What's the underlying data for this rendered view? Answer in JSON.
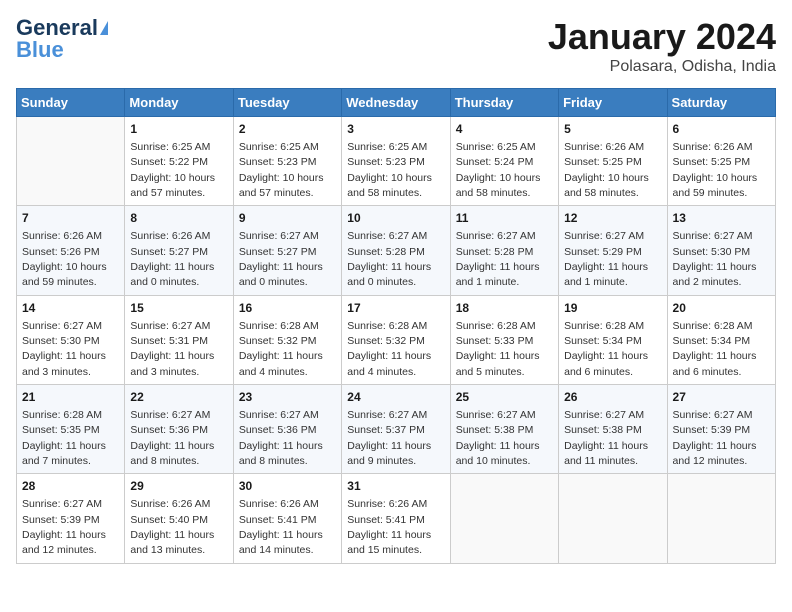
{
  "header": {
    "logo_line1": "General",
    "logo_line2": "Blue",
    "month": "January 2024",
    "location": "Polasara, Odisha, India"
  },
  "days_of_week": [
    "Sunday",
    "Monday",
    "Tuesday",
    "Wednesday",
    "Thursday",
    "Friday",
    "Saturday"
  ],
  "weeks": [
    [
      {
        "day": "",
        "info": ""
      },
      {
        "day": "1",
        "info": "Sunrise: 6:25 AM\nSunset: 5:22 PM\nDaylight: 10 hours and 57 minutes."
      },
      {
        "day": "2",
        "info": "Sunrise: 6:25 AM\nSunset: 5:23 PM\nDaylight: 10 hours and 57 minutes."
      },
      {
        "day": "3",
        "info": "Sunrise: 6:25 AM\nSunset: 5:23 PM\nDaylight: 10 hours and 58 minutes."
      },
      {
        "day": "4",
        "info": "Sunrise: 6:25 AM\nSunset: 5:24 PM\nDaylight: 10 hours and 58 minutes."
      },
      {
        "day": "5",
        "info": "Sunrise: 6:26 AM\nSunset: 5:25 PM\nDaylight: 10 hours and 58 minutes."
      },
      {
        "day": "6",
        "info": "Sunrise: 6:26 AM\nSunset: 5:25 PM\nDaylight: 10 hours and 59 minutes."
      }
    ],
    [
      {
        "day": "7",
        "info": "Sunrise: 6:26 AM\nSunset: 5:26 PM\nDaylight: 10 hours and 59 minutes."
      },
      {
        "day": "8",
        "info": "Sunrise: 6:26 AM\nSunset: 5:27 PM\nDaylight: 11 hours and 0 minutes."
      },
      {
        "day": "9",
        "info": "Sunrise: 6:27 AM\nSunset: 5:27 PM\nDaylight: 11 hours and 0 minutes."
      },
      {
        "day": "10",
        "info": "Sunrise: 6:27 AM\nSunset: 5:28 PM\nDaylight: 11 hours and 0 minutes."
      },
      {
        "day": "11",
        "info": "Sunrise: 6:27 AM\nSunset: 5:28 PM\nDaylight: 11 hours and 1 minute."
      },
      {
        "day": "12",
        "info": "Sunrise: 6:27 AM\nSunset: 5:29 PM\nDaylight: 11 hours and 1 minute."
      },
      {
        "day": "13",
        "info": "Sunrise: 6:27 AM\nSunset: 5:30 PM\nDaylight: 11 hours and 2 minutes."
      }
    ],
    [
      {
        "day": "14",
        "info": "Sunrise: 6:27 AM\nSunset: 5:30 PM\nDaylight: 11 hours and 3 minutes."
      },
      {
        "day": "15",
        "info": "Sunrise: 6:27 AM\nSunset: 5:31 PM\nDaylight: 11 hours and 3 minutes."
      },
      {
        "day": "16",
        "info": "Sunrise: 6:28 AM\nSunset: 5:32 PM\nDaylight: 11 hours and 4 minutes."
      },
      {
        "day": "17",
        "info": "Sunrise: 6:28 AM\nSunset: 5:32 PM\nDaylight: 11 hours and 4 minutes."
      },
      {
        "day": "18",
        "info": "Sunrise: 6:28 AM\nSunset: 5:33 PM\nDaylight: 11 hours and 5 minutes."
      },
      {
        "day": "19",
        "info": "Sunrise: 6:28 AM\nSunset: 5:34 PM\nDaylight: 11 hours and 6 minutes."
      },
      {
        "day": "20",
        "info": "Sunrise: 6:28 AM\nSunset: 5:34 PM\nDaylight: 11 hours and 6 minutes."
      }
    ],
    [
      {
        "day": "21",
        "info": "Sunrise: 6:28 AM\nSunset: 5:35 PM\nDaylight: 11 hours and 7 minutes."
      },
      {
        "day": "22",
        "info": "Sunrise: 6:27 AM\nSunset: 5:36 PM\nDaylight: 11 hours and 8 minutes."
      },
      {
        "day": "23",
        "info": "Sunrise: 6:27 AM\nSunset: 5:36 PM\nDaylight: 11 hours and 8 minutes."
      },
      {
        "day": "24",
        "info": "Sunrise: 6:27 AM\nSunset: 5:37 PM\nDaylight: 11 hours and 9 minutes."
      },
      {
        "day": "25",
        "info": "Sunrise: 6:27 AM\nSunset: 5:38 PM\nDaylight: 11 hours and 10 minutes."
      },
      {
        "day": "26",
        "info": "Sunrise: 6:27 AM\nSunset: 5:38 PM\nDaylight: 11 hours and 11 minutes."
      },
      {
        "day": "27",
        "info": "Sunrise: 6:27 AM\nSunset: 5:39 PM\nDaylight: 11 hours and 12 minutes."
      }
    ],
    [
      {
        "day": "28",
        "info": "Sunrise: 6:27 AM\nSunset: 5:39 PM\nDaylight: 11 hours and 12 minutes."
      },
      {
        "day": "29",
        "info": "Sunrise: 6:26 AM\nSunset: 5:40 PM\nDaylight: 11 hours and 13 minutes."
      },
      {
        "day": "30",
        "info": "Sunrise: 6:26 AM\nSunset: 5:41 PM\nDaylight: 11 hours and 14 minutes."
      },
      {
        "day": "31",
        "info": "Sunrise: 6:26 AM\nSunset: 5:41 PM\nDaylight: 11 hours and 15 minutes."
      },
      {
        "day": "",
        "info": ""
      },
      {
        "day": "",
        "info": ""
      },
      {
        "day": "",
        "info": ""
      }
    ]
  ]
}
